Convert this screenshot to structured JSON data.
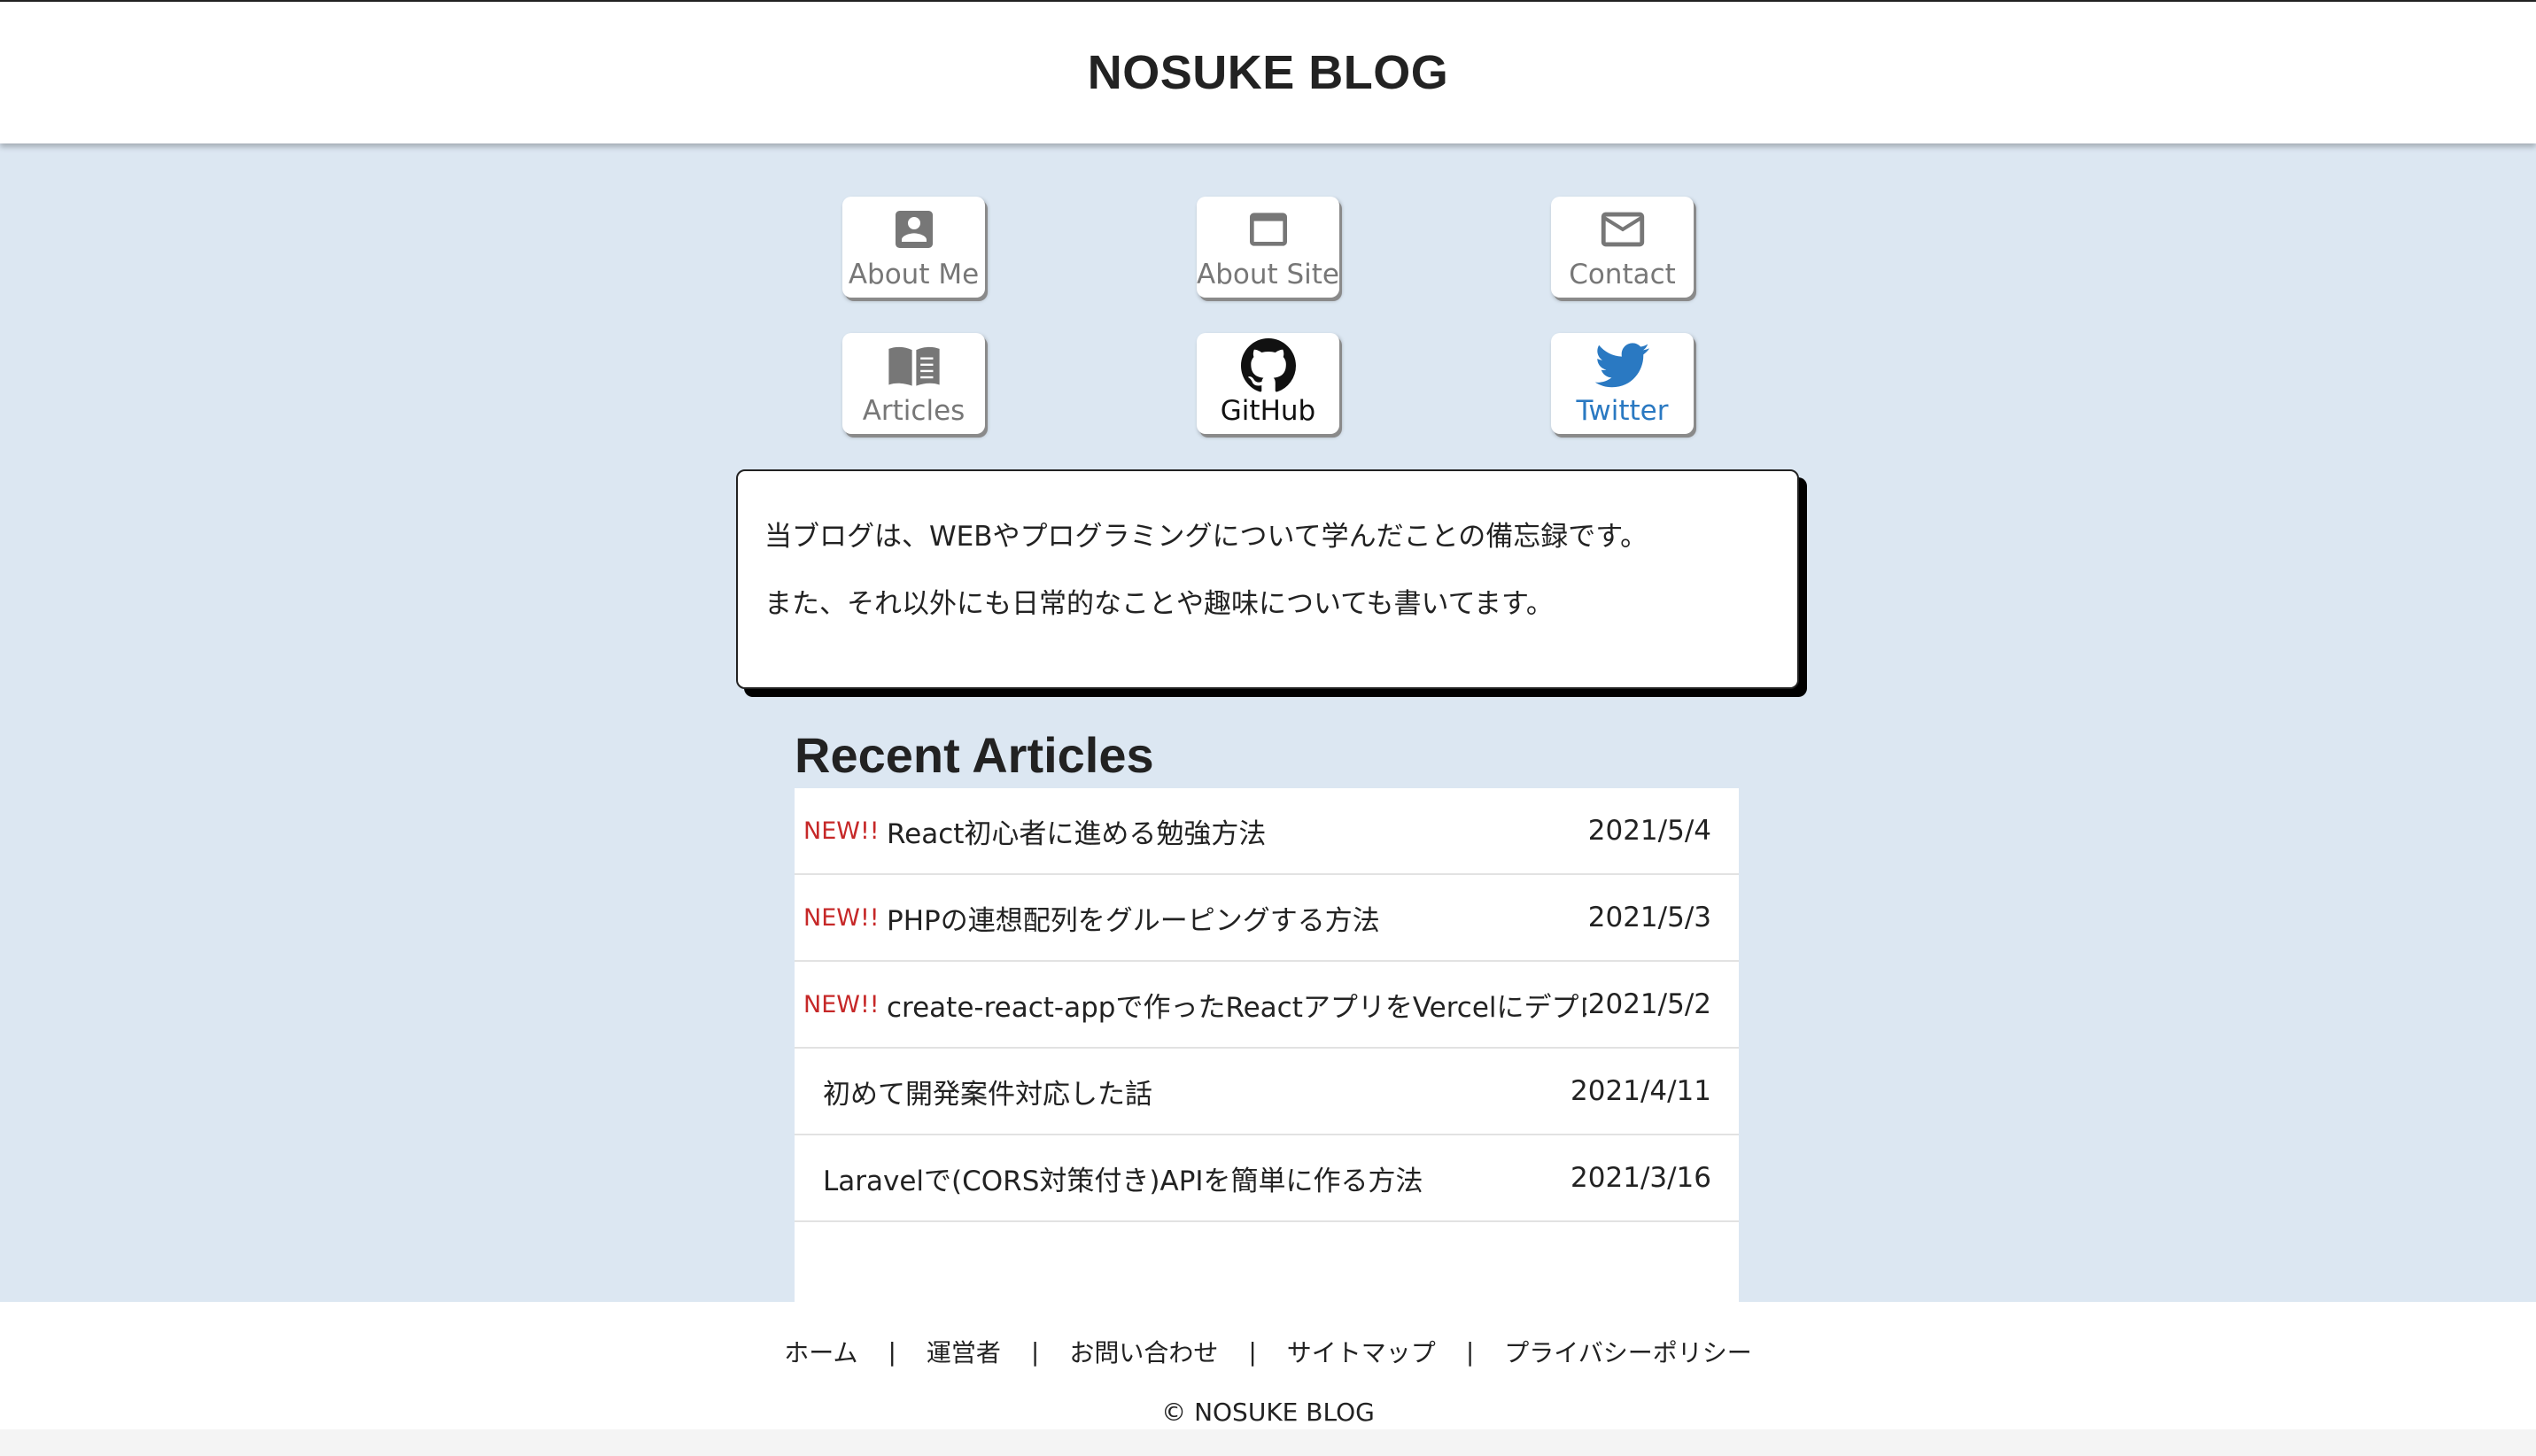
{
  "site": {
    "title": "NOSUKE BLOG"
  },
  "nav": {
    "about_me": {
      "label": "About Me",
      "icon": "person-icon"
    },
    "about_site": {
      "label": "About Site",
      "icon": "window-icon"
    },
    "contact": {
      "label": "Contact",
      "icon": "mail-icon"
    },
    "articles": {
      "label": "Articles",
      "icon": "book-icon"
    },
    "github": {
      "label": "GitHub",
      "icon": "github-icon"
    },
    "twitter": {
      "label": "Twitter",
      "icon": "twitter-icon"
    }
  },
  "intro": {
    "line1": "当ブログは、WEBやプログラミングについて学んだことの備忘録です。",
    "line2": "また、それ以外にも日常的なことや趣味についても書いてます。"
  },
  "recent": {
    "heading": "Recent Articles",
    "items": [
      {
        "new_badge": "NEW!!",
        "title": "React初心者に進める勉強方法",
        "date": "2021/5/4"
      },
      {
        "new_badge": "NEW!!",
        "title": "PHPの連想配列をグルーピングする方法",
        "date": "2021/5/3"
      },
      {
        "new_badge": "NEW!!",
        "title": "create-react-appで作ったReactアプリをVercelにデプロイ",
        "date": "2021/5/2"
      },
      {
        "new_badge": "",
        "title": "初めて開発案件対応した話",
        "date": "2021/4/11"
      },
      {
        "new_badge": "",
        "title": "Laravelで(CORS対策付き)APIを簡単に作る方法",
        "date": "2021/3/16"
      }
    ]
  },
  "footer": {
    "links": [
      "ホーム",
      "運営者",
      "お問い合わせ",
      "サイトマップ",
      "プライバシーポリシー"
    ],
    "separator": "|",
    "copyright": "© NOSUKE BLOG"
  },
  "colors": {
    "main_bg": "#dce7f2",
    "new_badge": "#c62828",
    "twitter_blue": "#2a79c2",
    "icon_gray": "#777777"
  }
}
